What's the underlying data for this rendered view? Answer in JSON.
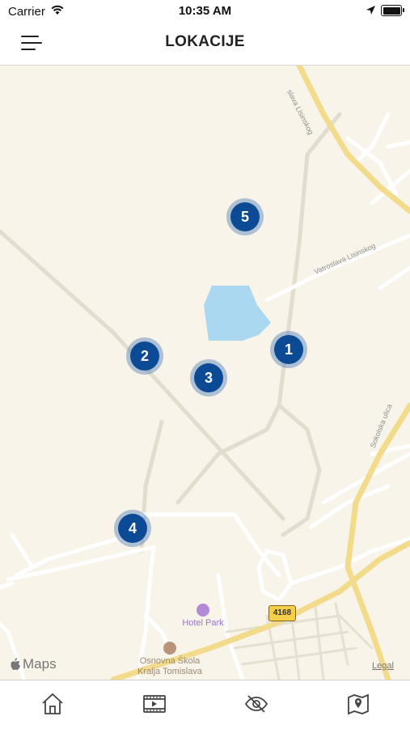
{
  "status_bar": {
    "carrier": "Carrier",
    "time": "10:35 AM"
  },
  "header": {
    "title": "LOKACIJE",
    "menu_icon": "hamburger-icon"
  },
  "map": {
    "road_labels": [
      "slava Lisinskog",
      "Vatroslava Lisinskog",
      "Sokolska ulica"
    ],
    "poi": [
      {
        "name": "Hotel Park",
        "icon": "hotel-icon",
        "color": "#b48ad8"
      },
      {
        "name_line1": "Osnovna Škola",
        "name_line2": "Kralja Tomislava",
        "icon": "school-icon",
        "color": "#b9947a"
      }
    ],
    "route_shield": "4168",
    "brand": "Maps",
    "legal": "Legal",
    "markers": [
      "1",
      "2",
      "3",
      "4",
      "5"
    ],
    "marker_color": "#0c4a95"
  },
  "tabbar": {
    "items": [
      {
        "icon": "home-icon"
      },
      {
        "icon": "video-icon"
      },
      {
        "icon": "eye-off-icon"
      },
      {
        "icon": "map-pin-icon"
      }
    ]
  }
}
